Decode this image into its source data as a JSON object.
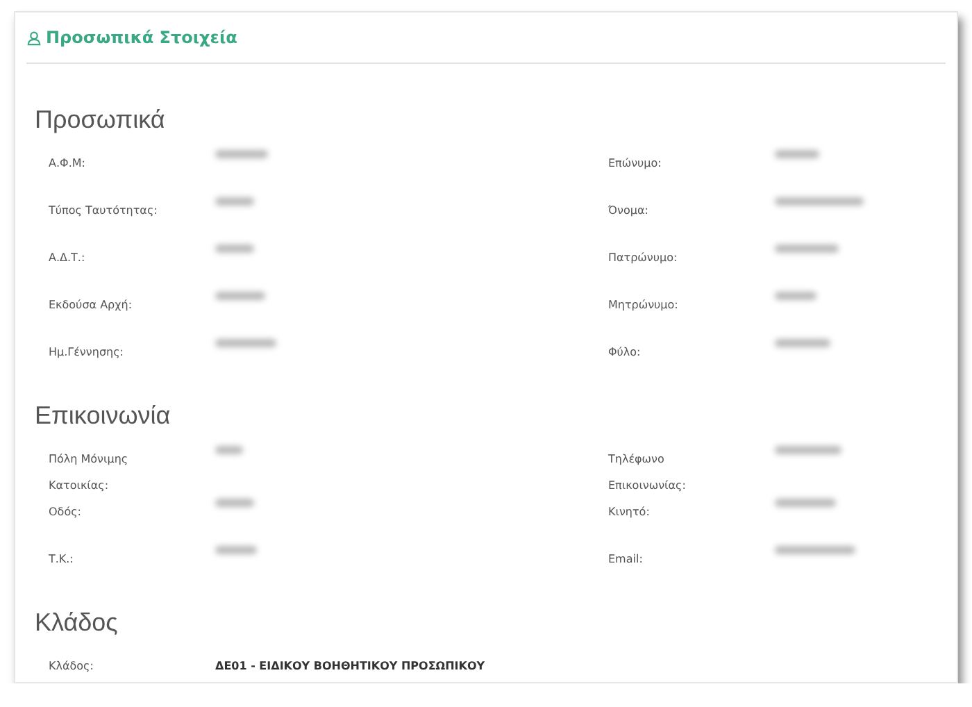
{
  "panel": {
    "title": "Προσωπικά Στοιχεία"
  },
  "sections": [
    {
      "title": "Προσωπικά",
      "rows": [
        {
          "left": {
            "label": "Α.Φ.Μ:",
            "kind": "blurred"
          },
          "right": {
            "label": "Επώνυμο:",
            "kind": "blurred"
          }
        },
        {
          "left": {
            "label": "Τύπος Ταυτότητας:",
            "kind": "blurred"
          },
          "right": {
            "label": "Όνομα:",
            "kind": "blurred"
          }
        },
        {
          "left": {
            "label": "Α.Δ.Τ.:",
            "kind": "blurred"
          },
          "right": {
            "label": "Πατρώνυμο:",
            "kind": "blurred"
          }
        },
        {
          "left": {
            "label": "Εκδούσα Αρχή:",
            "kind": "blurred"
          },
          "right": {
            "label": "Μητρώνυμο:",
            "kind": "blurred"
          }
        },
        {
          "left": {
            "label": "Ημ.Γέννησης:",
            "kind": "blurred"
          },
          "right": {
            "label": "Φύλο:",
            "kind": "blurred"
          }
        }
      ]
    },
    {
      "title": "Επικοινωνία",
      "rows": [
        {
          "left": {
            "label": "Πόλη Μόνιμης Κατοικίας:",
            "kind": "blurred"
          },
          "right": {
            "label": "Τηλέφωνο Επικοινωνίας:",
            "kind": "blurred"
          }
        },
        {
          "left": {
            "label": "Οδός:",
            "kind": "blurred"
          },
          "right": {
            "label": "Κινητό:",
            "kind": "blurred"
          }
        },
        {
          "left": {
            "label": "Τ.Κ.:",
            "kind": "blurred"
          },
          "right": {
            "label": "Email:",
            "kind": "blurred"
          }
        }
      ]
    },
    {
      "title": "Κλάδος",
      "rows": [
        {
          "left": {
            "label": "Κλάδος:",
            "kind": "text",
            "value": "ΔΕ01 - ΕΙΔΙΚΟΥ ΒΟΗΘΗΤΙΚΟΥ ΠΡΟΣΩΠΙΚΟΥ"
          }
        }
      ]
    }
  ]
}
